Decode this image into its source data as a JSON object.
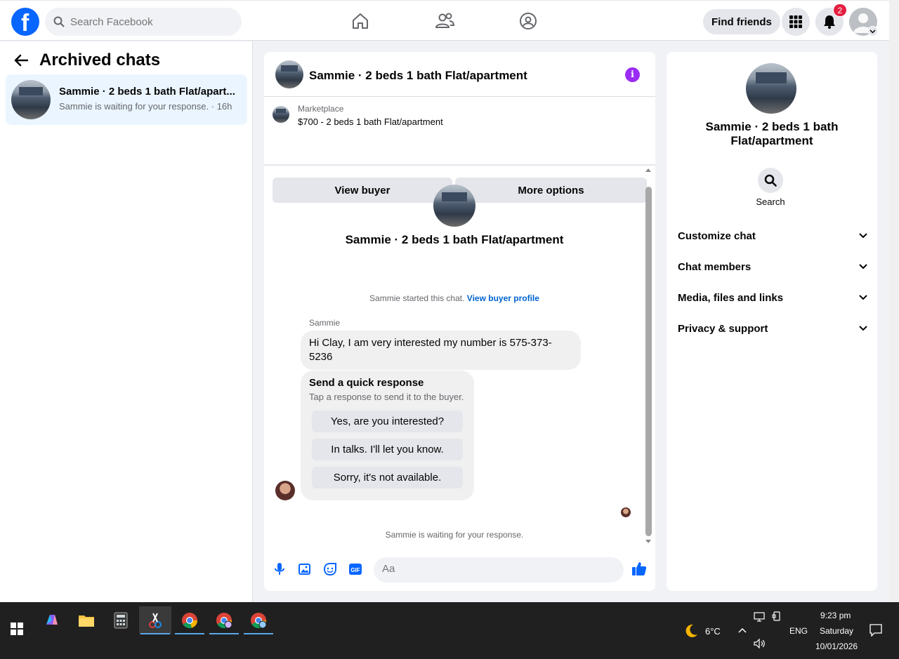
{
  "topbar": {
    "search_placeholder": "Search Facebook",
    "find_friends": "Find friends",
    "notification_count": "2"
  },
  "left": {
    "title": "Archived chats",
    "chats": [
      {
        "name": "Sammie · 2 beds 1 bath Flat/apart...",
        "subtitle": "Sammie is waiting for your response. · 16h"
      }
    ]
  },
  "conversation": {
    "title": "Sammie · 2 beds 1 bath Flat/apartment",
    "marketplace_label": "Marketplace",
    "listing": "$700 - 2 beds 1 bath Flat/apartment",
    "view_buyer": "View buyer",
    "more_options": "More options",
    "header_name": "Sammie · 2 beds 1 bath Flat/apartment",
    "started_text": "Sammie started this chat.",
    "view_buyer_profile": "View buyer profile",
    "sender": "Sammie",
    "message": "Hi Clay, I am very interested my number is 575-373-5236",
    "quick_response_title": "Send a quick response",
    "quick_response_sub": "Tap a response to send it to the buyer.",
    "quick_responses": [
      "Yes, are you interested?",
      "In talks. I'll let you know.",
      "Sorry, it's not available."
    ],
    "waiting": "Sammie is waiting for your response.",
    "composer_placeholder": "Aa"
  },
  "right": {
    "title": "Sammie · 2 beds 1 bath Flat/apartment",
    "search": "Search",
    "sections": [
      "Customize chat",
      "Chat members",
      "Media, files and links",
      "Privacy & support"
    ]
  },
  "taskbar": {
    "weather": "6°C",
    "lang": "ENG",
    "time": "9:23 pm",
    "day": "Saturday",
    "date": "10/01/2026"
  },
  "colors": {
    "brand": "#0866ff",
    "info": "#9a2cf3",
    "badge": "#e41e3f",
    "link": "#0064d1"
  }
}
